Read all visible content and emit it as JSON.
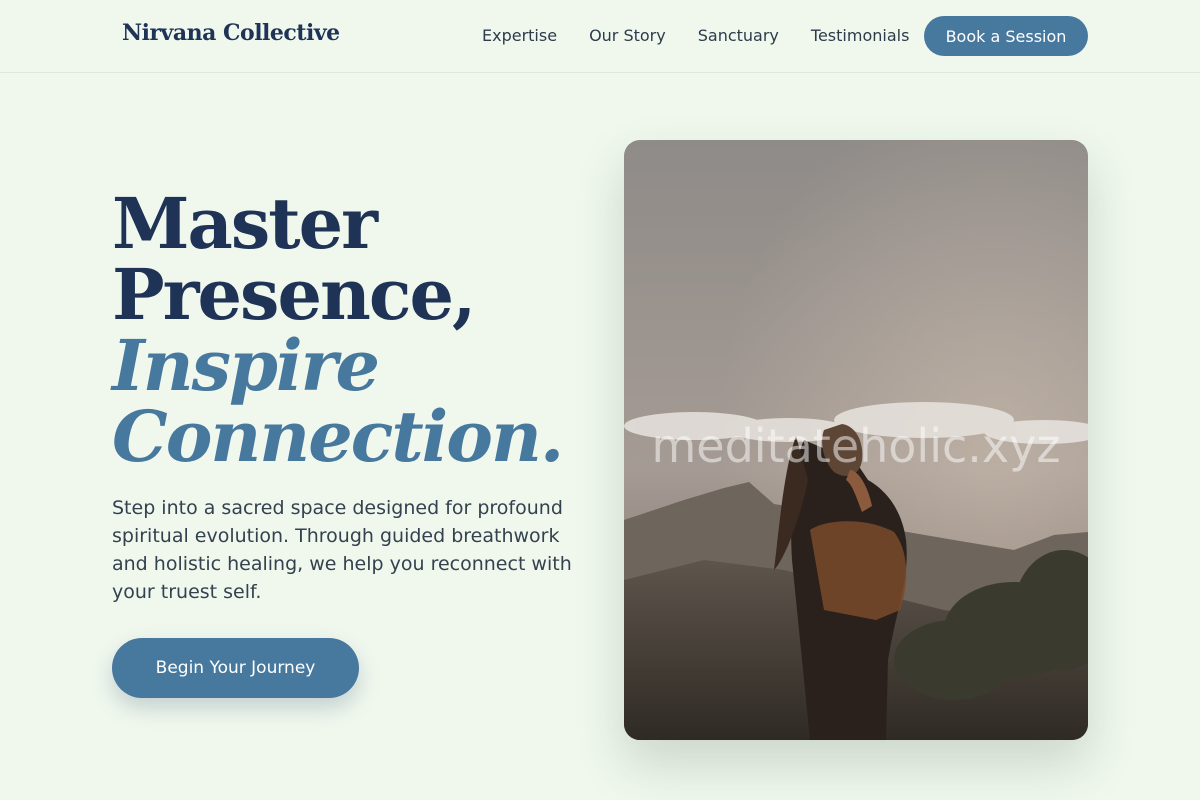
{
  "brand": {
    "name": "Nirvana Collective"
  },
  "nav": {
    "items": [
      {
        "label": "Expertise"
      },
      {
        "label": "Our Story"
      },
      {
        "label": "Sanctuary"
      },
      {
        "label": "Testimonials"
      }
    ],
    "cta_label": "Book a Session"
  },
  "hero": {
    "title_line1": "Master",
    "title_line2": "Presence,",
    "title_line3": "Inspire",
    "title_line4": "Connection.",
    "description": "Step into a sacred space designed for profound spiritual evolution. Through guided breathwork and holistic healing, we help you reconnect with your truest self.",
    "cta_label": "Begin Your Journey",
    "image_watermark": "meditateholic.xyz"
  },
  "colors": {
    "background": "#f0f8ee",
    "primary": "#47789e",
    "heading": "#1f3356",
    "text": "#34414e"
  }
}
